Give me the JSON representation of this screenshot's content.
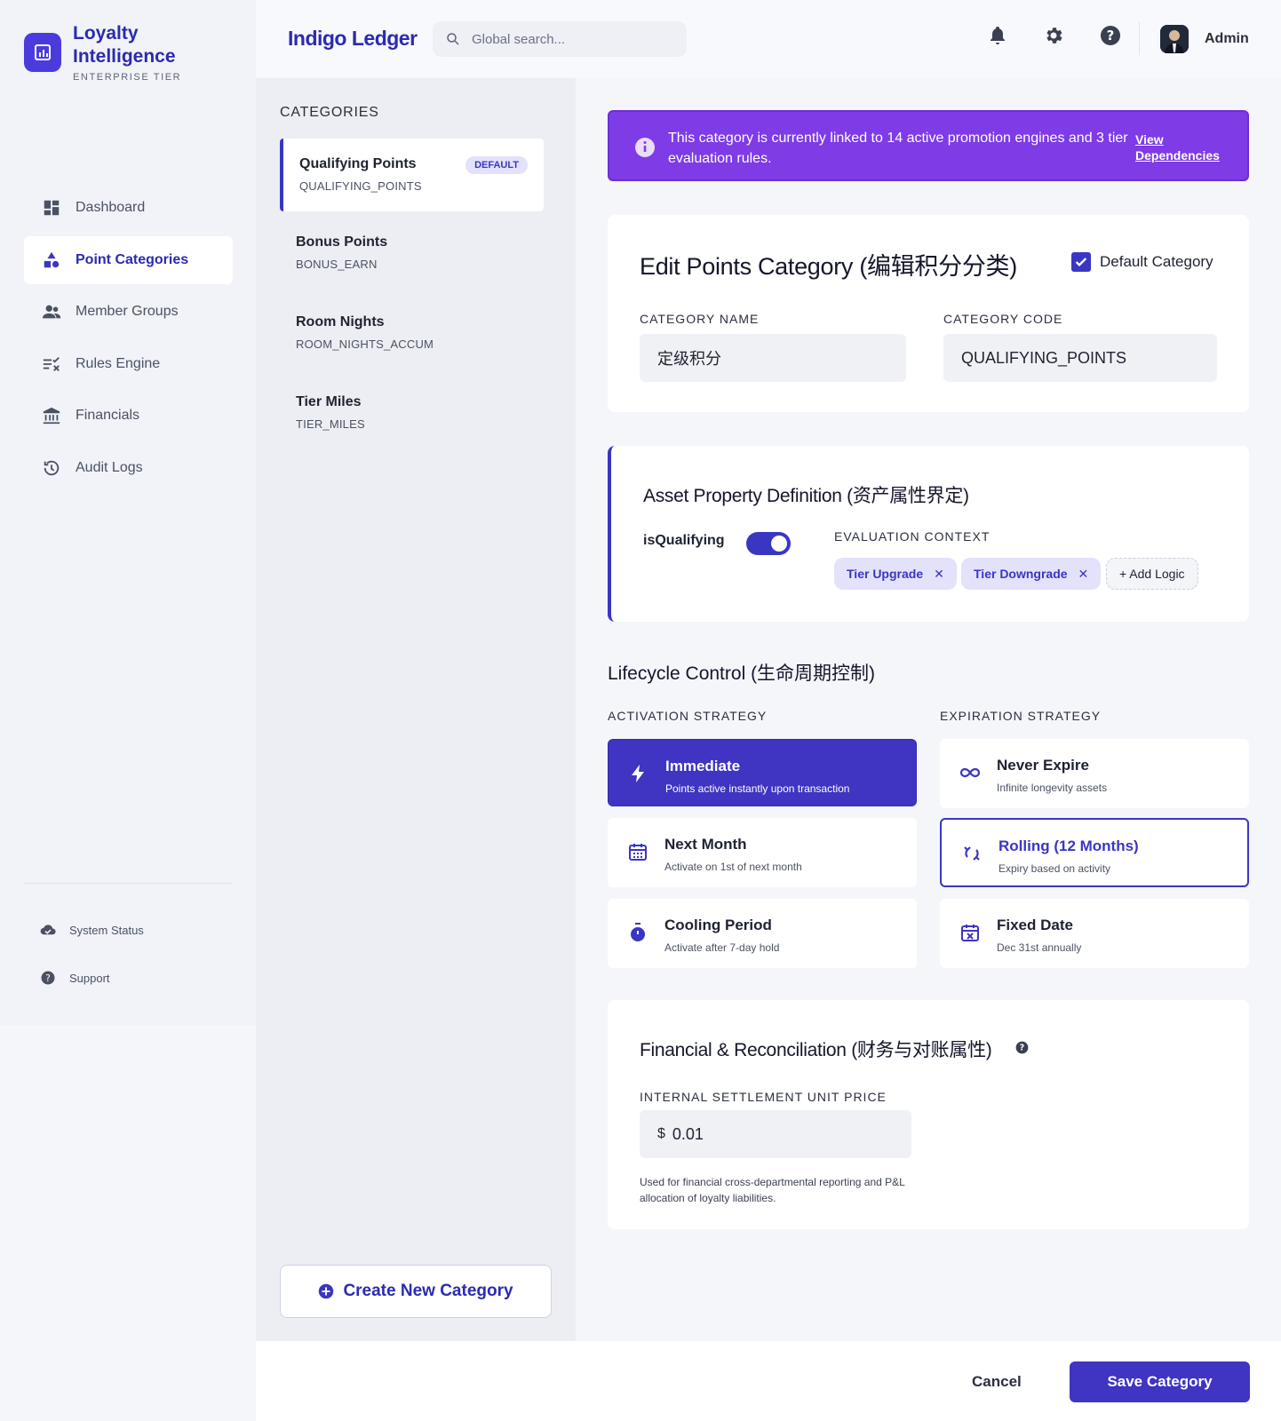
{
  "brand": {
    "name": "Loyalty Intelligence",
    "tier": "ENTERPRISE TIER"
  },
  "nav": [
    {
      "label": "Dashboard",
      "icon": "dashboard-icon"
    },
    {
      "label": "Point Categories",
      "icon": "shapes-icon",
      "active": true
    },
    {
      "label": "Member Groups",
      "icon": "group-icon"
    },
    {
      "label": "Rules Engine",
      "icon": "rules-icon"
    },
    {
      "label": "Financials",
      "icon": "bank-icon"
    },
    {
      "label": "Audit Logs",
      "icon": "history-icon"
    }
  ],
  "sidebar_footer": {
    "status": "System Status",
    "support": "Support"
  },
  "topbar": {
    "app_title": "Indigo Ledger",
    "search_placeholder": "Global search...",
    "user": "Admin"
  },
  "categories": {
    "heading": "CATEGORIES",
    "items": [
      {
        "name": "Qualifying Points",
        "code": "QUALIFYING_POINTS",
        "badge": "DEFAULT",
        "active": true
      },
      {
        "name": "Bonus Points",
        "code": "BONUS_EARN"
      },
      {
        "name": "Room Nights",
        "code": "ROOM_NIGHTS_ACCUM"
      },
      {
        "name": "Tier Miles",
        "code": "TIER_MILES"
      }
    ],
    "create_label": "Create New Category"
  },
  "banner": {
    "text": "This category is currently linked to 14 active promotion engines and 3 tier evaluation rules.",
    "link": "View Dependencies"
  },
  "edit": {
    "title": "Edit Points Category (编辑积分分类)",
    "default_label": "Default Category",
    "name_label": "CATEGORY NAME",
    "name_value": "定级积分",
    "code_label": "CATEGORY CODE",
    "code_value": "QUALIFYING_POINTS"
  },
  "asset": {
    "title": "Asset Property Definition (资产属性界定)",
    "toggle_label": "isQualifying",
    "toggle_on": true,
    "context_label": "EVALUATION CONTEXT",
    "chips": [
      "Tier Upgrade",
      "Tier Downgrade"
    ],
    "add_label": "+ Add Logic"
  },
  "lifecycle": {
    "title": "Lifecycle Control (生命周期控制)",
    "activation_label": "ACTIVATION STRATEGY",
    "expiration_label": "EXPIRATION STRATEGY",
    "activation": [
      {
        "title": "Immediate",
        "sub": "Points active instantly upon transaction",
        "selected": true
      },
      {
        "title": "Next Month",
        "sub": "Activate on 1st of next month"
      },
      {
        "title": "Cooling Period",
        "sub": "Activate after 7-day hold"
      }
    ],
    "expiration": [
      {
        "title": "Never Expire",
        "sub": "Infinite longevity assets"
      },
      {
        "title": "Rolling (12 Months)",
        "sub": "Expiry based on activity",
        "selected": true
      },
      {
        "title": "Fixed Date",
        "sub": "Dec 31st annually"
      }
    ]
  },
  "financial": {
    "title": "Financial & Reconciliation (财务与对账属性)",
    "price_label": "INTERNAL SETTLEMENT UNIT PRICE",
    "currency": "$",
    "price_value": "0.01",
    "note": "Used for financial cross-departmental reporting and P&L allocation of loyalty liabilities."
  },
  "footer": {
    "cancel": "Cancel",
    "save": "Save Category"
  },
  "colors": {
    "primary": "#3a36c4",
    "banner": "#7e3be6",
    "chip_bg": "#e4e1fb"
  }
}
